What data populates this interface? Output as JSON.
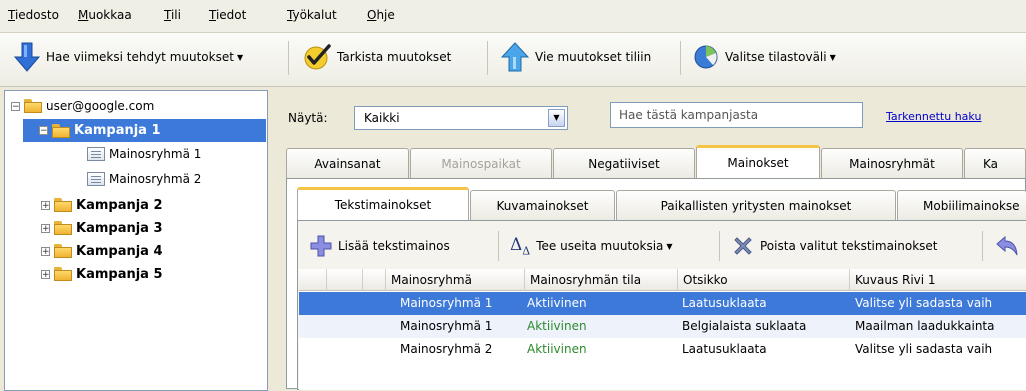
{
  "menu": [
    "Tiedosto",
    "Muokkaa",
    "Tili",
    "Tiedot",
    "Työkalut",
    "Ohje"
  ],
  "toolbar": {
    "get_changes": "Hae viimeksi tehdyt muutokset",
    "check_changes": "Tarkista muutokset",
    "post_changes": "Vie muutokset tiliin",
    "stats_range": "Valitse tilastoväli"
  },
  "tree": {
    "account": "user@google.com",
    "campaign1": "Kampanja 1",
    "adgroup1": "Mainosryhmä 1",
    "adgroup2": "Mainosryhmä 2",
    "campaign2": "Kampanja 2",
    "campaign3": "Kampanja 3",
    "campaign4": "Kampanja 4",
    "campaign5": "Kampanja 5"
  },
  "filter": {
    "show_label": "Näytä:",
    "show_value": "Kaikki",
    "search_placeholder": "Hae tästä kampanjasta",
    "advanced_search": "Tarkennettu haku"
  },
  "tabs": [
    "Avainsanat",
    "Mainospaikat",
    "Negatiiviset",
    "Mainokset",
    "Mainosryhmät",
    "Ka"
  ],
  "subtabs": [
    "Tekstimainokset",
    "Kuvamainokset",
    "Paikallisten yritysten mainokset",
    "Mobiilimainokse"
  ],
  "actions": {
    "add": "Lisää tekstimainos",
    "multi": "Tee useita muutoksia",
    "delete": "Poista valitut tekstimainokset"
  },
  "columns": [
    "Mainosryhmä",
    "Mainosryhmän tila",
    "Otsikko",
    "Kuvaus Rivi 1"
  ],
  "rows": [
    {
      "adgroup": "Mainosryhmä 1",
      "status": "Aktiivinen",
      "headline": "Laatusuklaata",
      "desc": "Valitse yli sadasta vaih"
    },
    {
      "adgroup": "Mainosryhmä 1",
      "status": "Aktiivinen",
      "headline": "Belgialaista suklaata",
      "desc": "Maailman laadukkainta"
    },
    {
      "adgroup": "Mainosryhmä 2",
      "status": "Aktiivinen",
      "headline": "Laatusuklaata",
      "desc": "Valitse yli sadasta vaih"
    }
  ],
  "colors": {
    "selection": "#3d79d9",
    "status_active": "#2d8a2d",
    "link": "#0000cc"
  }
}
